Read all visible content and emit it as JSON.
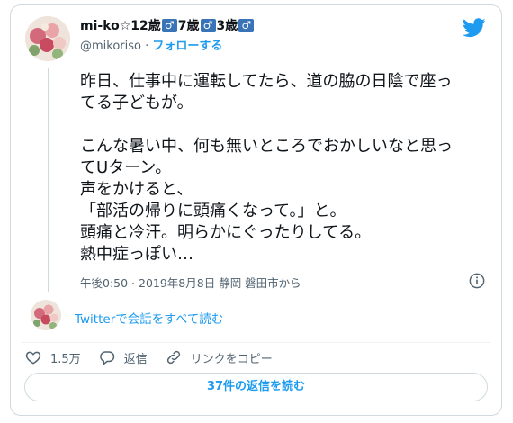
{
  "tweet": {
    "author_name": "mi-ko☆12歳",
    "author_name_parts": [
      "mi-ko☆12歳",
      "7歳",
      "3歳"
    ],
    "male_symbol": "♂",
    "handle": "@mikoriso",
    "separator": "·",
    "follow_label": "フォローする",
    "body_lines": [
      "昨日、仕事中に運転してたら、道の脇の日陰で座っ",
      "てる子どもが。",
      "",
      "こんな暑い中、何も無いところでおかしいなと思っ",
      "てUターン。",
      "声をかけると、",
      "「部活の帰りに頭痛くなって。」と。",
      "頭痛と冷汗。明らかにぐったりしてる。",
      "熱中症っぽい…"
    ],
    "timestamp": "午後0:50 · 2019年8月8日",
    "location": "静岡 磐田市から",
    "read_conversation_label": "Twitterで会話をすべて読む",
    "like_count": "1.5万",
    "reply_label": "返信",
    "copy_link_label": "リンクをコピー",
    "read_replies_label": "37件の返信を読む"
  },
  "colors": {
    "accent": "#1d9bf0",
    "male_badge": "#3a74b8",
    "secondary_text": "#536471",
    "border": "#cfd9de"
  },
  "icons": [
    "twitter-bird-icon",
    "info-icon",
    "heart-icon",
    "reply-icon",
    "link-icon"
  ]
}
